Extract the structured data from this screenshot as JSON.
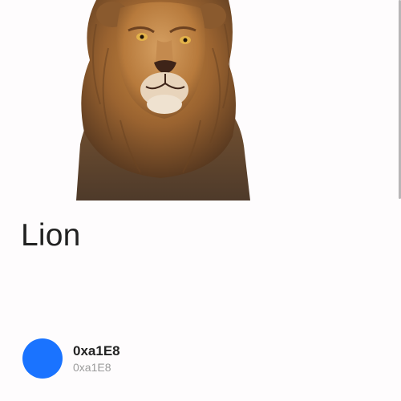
{
  "item": {
    "image_icon": "lion-photo",
    "title": "Lion"
  },
  "owner": {
    "avatar_color": "#1a73ff",
    "name": "0xa1E8",
    "address": "0xa1E8"
  }
}
